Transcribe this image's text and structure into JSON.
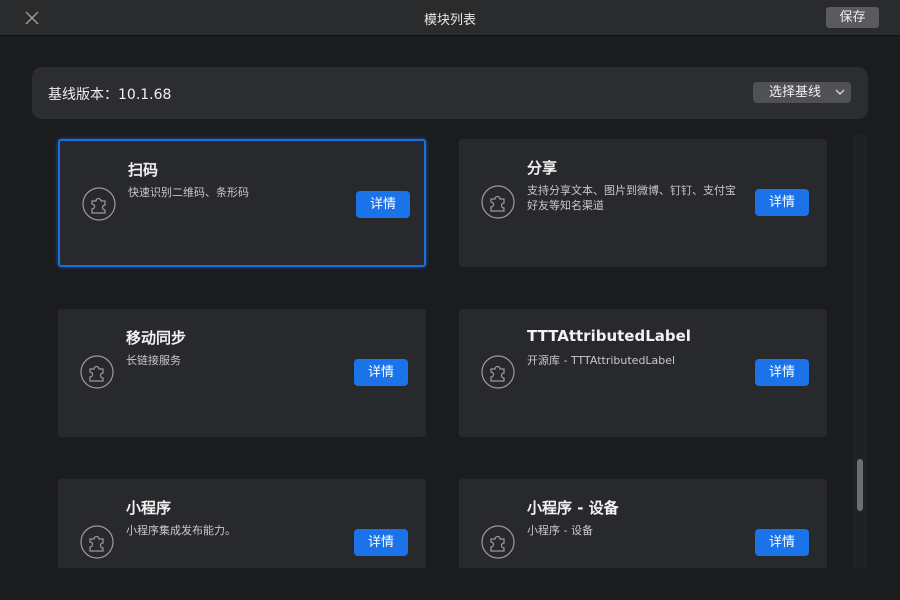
{
  "window": {
    "title": "模块列表",
    "save_label": "保存"
  },
  "baseline": {
    "label": "基线版本：10.1.68",
    "select_label": "选择基线"
  },
  "modules": [
    {
      "name": "扫码",
      "desc": "快速识别二维码、条形码",
      "button": "详情",
      "selected": true
    },
    {
      "name": "分享",
      "desc": "支持分享文本、图片到微博、钉钉、支付宝好友等知名渠道",
      "button": "详情",
      "selected": false
    },
    {
      "name": "移动同步",
      "desc": "长链接服务",
      "button": "详情",
      "selected": false
    },
    {
      "name": "TTTAttributedLabel",
      "desc": "开源库 - TTTAttributedLabel",
      "button": "详情",
      "selected": false
    },
    {
      "name": "小程序",
      "desc": "小程序集成发布能力。",
      "button": "详情",
      "selected": false
    },
    {
      "name": "小程序 - 设备",
      "desc": "小程序 - 设备",
      "button": "详情",
      "selected": false
    }
  ],
  "scroll": {
    "position": 0.85
  },
  "colors": {
    "accent": "#1a73e8",
    "card": "#28292c",
    "background": "#1b1c1e"
  }
}
